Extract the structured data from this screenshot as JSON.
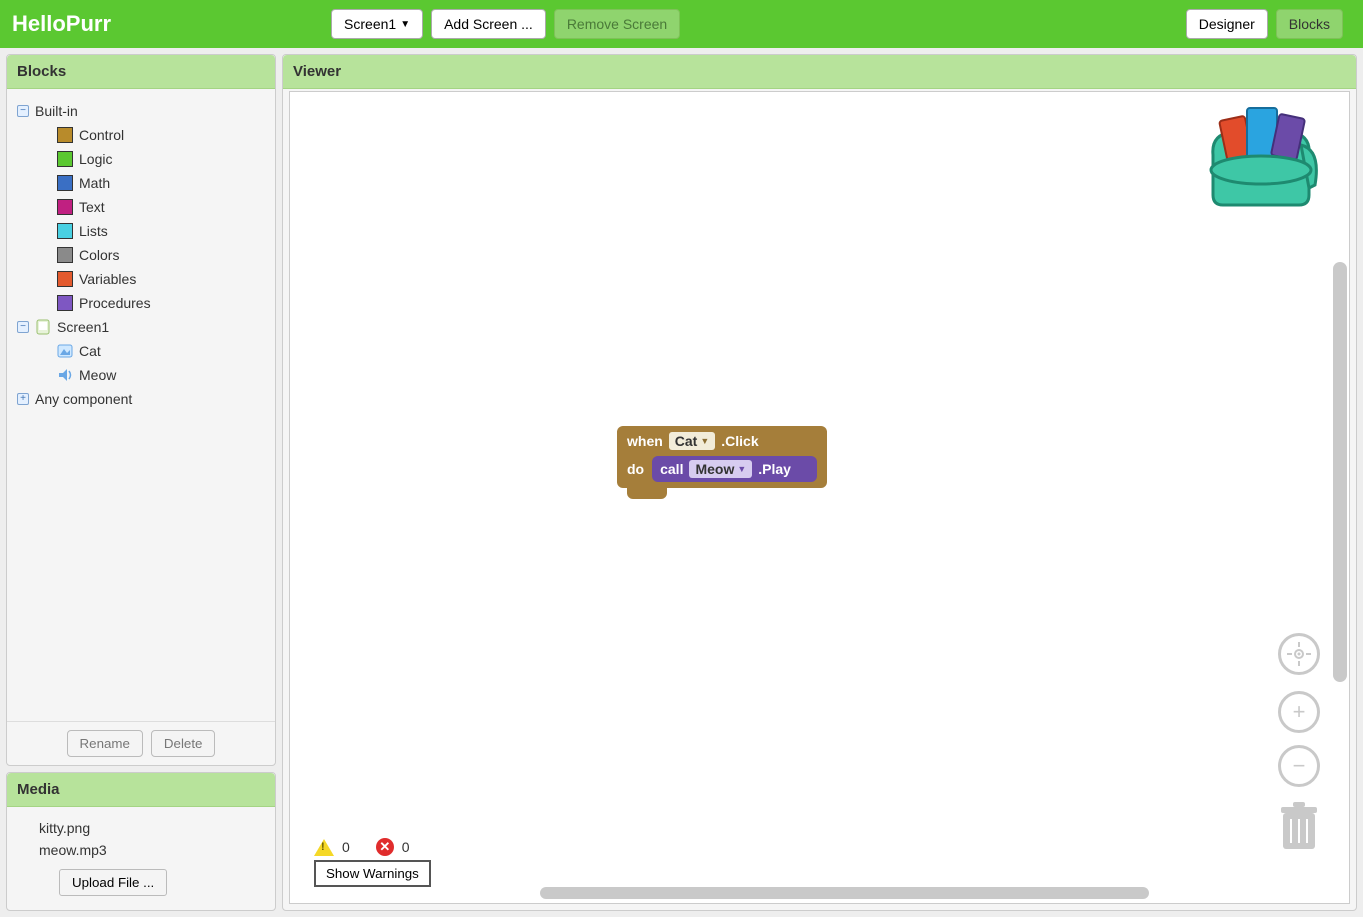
{
  "topbar": {
    "app_title": "HelloPurr",
    "screen_selector": "Screen1",
    "add_screen": "Add Screen ...",
    "remove_screen": "Remove Screen",
    "designer": "Designer",
    "blocks": "Blocks"
  },
  "panels": {
    "blocks_title": "Blocks",
    "viewer_title": "Viewer",
    "media_title": "Media"
  },
  "tree": {
    "builtin_label": "Built-in",
    "categories": [
      {
        "label": "Control",
        "color": "#b88b2b"
      },
      {
        "label": "Logic",
        "color": "#5bc831"
      },
      {
        "label": "Math",
        "color": "#3a6fc4"
      },
      {
        "label": "Text",
        "color": "#c02081"
      },
      {
        "label": "Lists",
        "color": "#49d0e2"
      },
      {
        "label": "Colors",
        "color": "#8a8a8a"
      },
      {
        "label": "Variables",
        "color": "#e35a2e"
      },
      {
        "label": "Procedures",
        "color": "#7e57c2"
      }
    ],
    "screen1": "Screen1",
    "cat": "Cat",
    "meow": "Meow",
    "any_component": "Any component"
  },
  "blocks_buttons": {
    "rename": "Rename",
    "delete": "Delete"
  },
  "media": {
    "files": [
      "kitty.png",
      "meow.mp3"
    ],
    "upload": "Upload File ..."
  },
  "warnings": {
    "warn_count": "0",
    "err_count": "0",
    "show_warnings": "Show Warnings"
  },
  "block": {
    "when": "when",
    "when_target": "Cat",
    "when_event": ".Click",
    "do": "do",
    "call": "call",
    "call_target": "Meow",
    "call_method": ".Play"
  }
}
